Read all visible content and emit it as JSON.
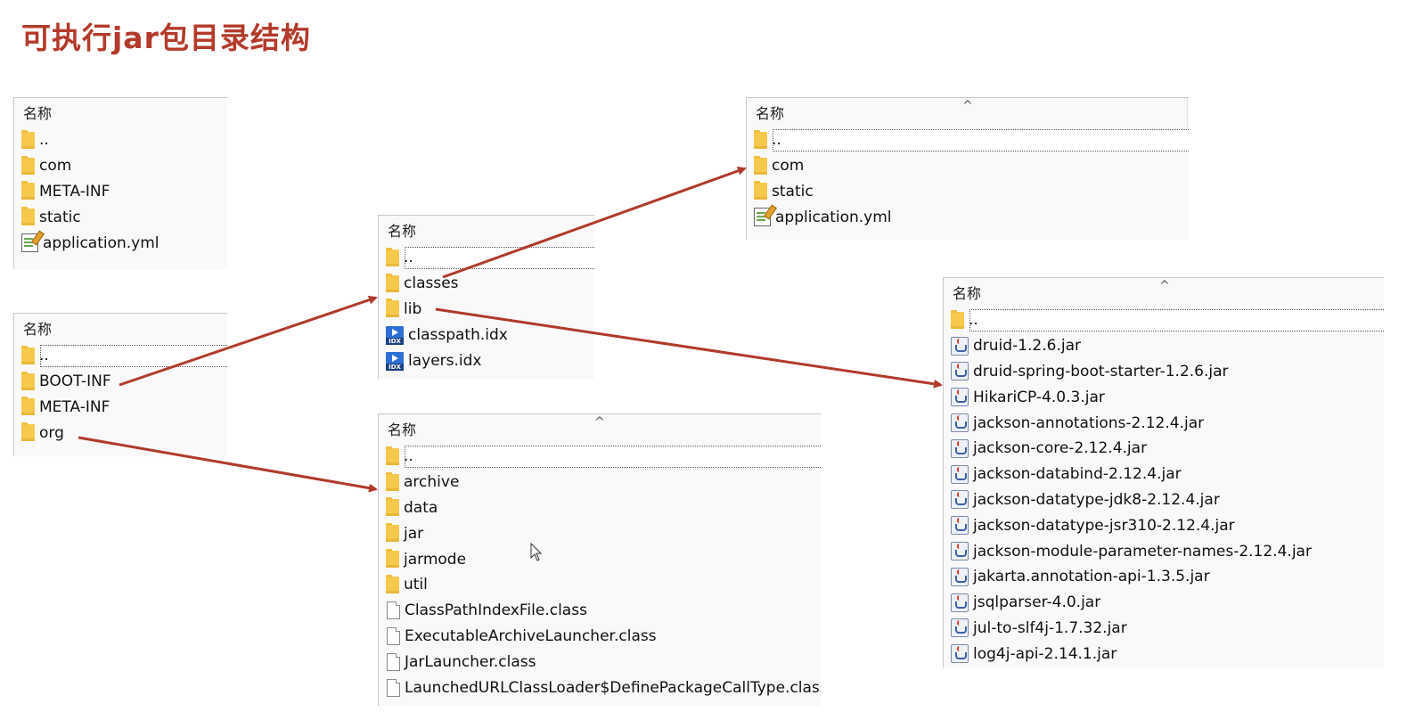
{
  "page": {
    "title": "可执行jar包目录结构"
  },
  "column_header": "名称",
  "panels": {
    "spring_boot_classes": {
      "items": [
        {
          "icon": "folder-icon",
          "label": ".."
        },
        {
          "icon": "folder-icon",
          "label": "com"
        },
        {
          "icon": "folder-icon",
          "label": "META-INF"
        },
        {
          "icon": "folder-icon",
          "label": "static"
        },
        {
          "icon": "yml-file-icon",
          "label": "application.yml"
        }
      ]
    },
    "jar_root": {
      "items": [
        {
          "icon": "folder-icon",
          "label": ".."
        },
        {
          "icon": "folder-icon",
          "label": "BOOT-INF"
        },
        {
          "icon": "folder-icon",
          "label": "META-INF"
        },
        {
          "icon": "folder-icon",
          "label": "org"
        }
      ]
    },
    "boot_inf": {
      "items": [
        {
          "icon": "folder-icon",
          "label": ".."
        },
        {
          "icon": "folder-icon",
          "label": "classes"
        },
        {
          "icon": "folder-icon",
          "label": "lib"
        },
        {
          "icon": "idx-file-icon",
          "label": "classpath.idx"
        },
        {
          "icon": "idx-file-icon",
          "label": "layers.idx"
        }
      ]
    },
    "loader": {
      "items": [
        {
          "icon": "folder-icon",
          "label": ".."
        },
        {
          "icon": "folder-icon",
          "label": "archive"
        },
        {
          "icon": "folder-icon",
          "label": "data"
        },
        {
          "icon": "folder-icon",
          "label": "jar"
        },
        {
          "icon": "folder-icon",
          "label": "jarmode"
        },
        {
          "icon": "folder-icon",
          "label": "util"
        },
        {
          "icon": "class-file-icon",
          "label": "ClassPathIndexFile.class"
        },
        {
          "icon": "class-file-icon",
          "label": "ExecutableArchiveLauncher.class"
        },
        {
          "icon": "class-file-icon",
          "label": "JarLauncher.class"
        },
        {
          "icon": "class-file-icon",
          "label": "LaunchedURLClassLoader$DefinePackageCallType.class"
        }
      ]
    },
    "classes": {
      "items": [
        {
          "icon": "folder-icon",
          "label": ".."
        },
        {
          "icon": "folder-icon",
          "label": "com"
        },
        {
          "icon": "folder-icon",
          "label": "static"
        },
        {
          "icon": "yml-file-icon",
          "label": "application.yml"
        }
      ]
    },
    "lib": {
      "items": [
        {
          "icon": "folder-icon",
          "label": ".."
        },
        {
          "icon": "jar-file-icon",
          "label": "druid-1.2.6.jar"
        },
        {
          "icon": "jar-file-icon",
          "label": "druid-spring-boot-starter-1.2.6.jar"
        },
        {
          "icon": "jar-file-icon",
          "label": "HikariCP-4.0.3.jar"
        },
        {
          "icon": "jar-file-icon",
          "label": "jackson-annotations-2.12.4.jar"
        },
        {
          "icon": "jar-file-icon",
          "label": "jackson-core-2.12.4.jar"
        },
        {
          "icon": "jar-file-icon",
          "label": "jackson-databind-2.12.4.jar"
        },
        {
          "icon": "jar-file-icon",
          "label": "jackson-datatype-jdk8-2.12.4.jar"
        },
        {
          "icon": "jar-file-icon",
          "label": "jackson-datatype-jsr310-2.12.4.jar"
        },
        {
          "icon": "jar-file-icon",
          "label": "jackson-module-parameter-names-2.12.4.jar"
        },
        {
          "icon": "jar-file-icon",
          "label": "jakarta.annotation-api-1.3.5.jar"
        },
        {
          "icon": "jar-file-icon",
          "label": "jsqlparser-4.0.jar"
        },
        {
          "icon": "jar-file-icon",
          "label": "jul-to-slf4j-1.7.32.jar"
        },
        {
          "icon": "jar-file-icon",
          "label": "log4j-api-2.14.1.jar"
        }
      ]
    }
  },
  "colors": {
    "title": "#b33a2a",
    "arrow": "#b03a2a",
    "folder": "#f6c94d"
  }
}
